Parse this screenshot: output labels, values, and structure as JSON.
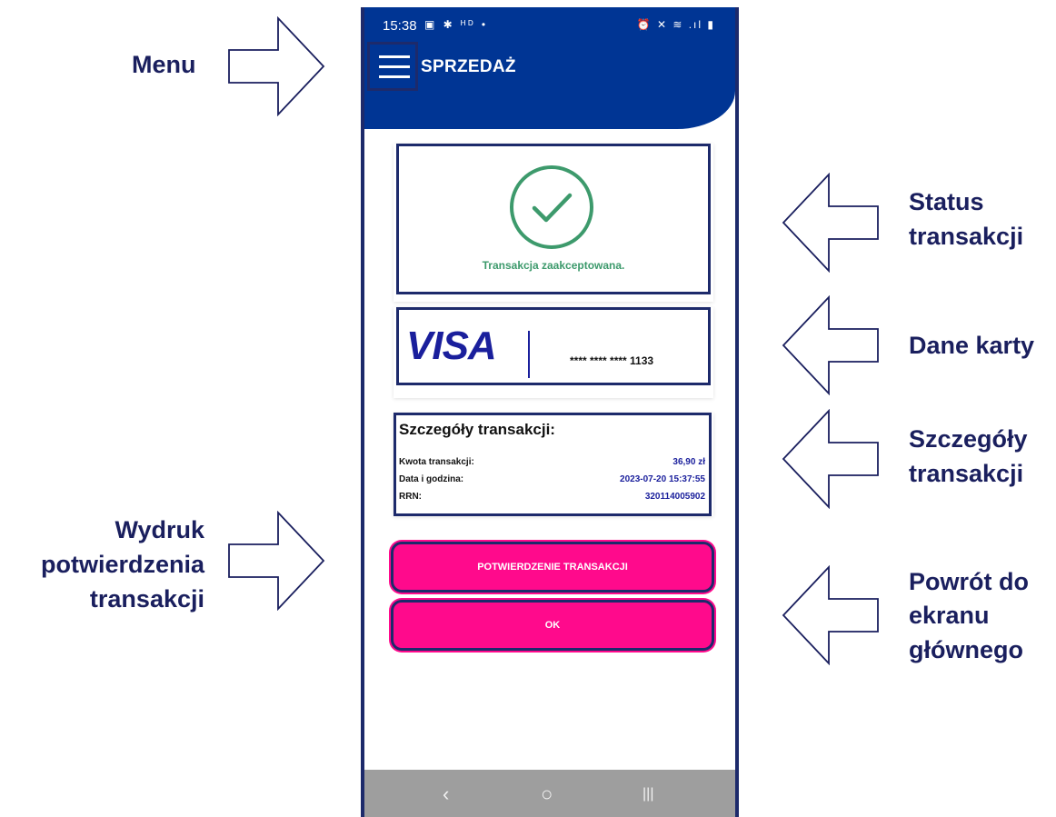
{
  "callouts": {
    "menu": "Menu",
    "status": [
      "Status",
      "transakcji"
    ],
    "card": "Dane karty",
    "details": [
      "Szczegóły",
      "transakcji"
    ],
    "print": [
      "Wydruk",
      "potwierdzenia",
      "transakcji"
    ],
    "back": [
      "Powrót do",
      "ekranu",
      "głównego"
    ]
  },
  "statusbar": {
    "time": "15:38",
    "left_icons": "▣ ✱ ᴴᴰ •",
    "right_icons": "⏰ ✕ ≋ .ıl ▮"
  },
  "header": {
    "menu_icon": "hamburger-icon",
    "title": "SPRZEDAŻ"
  },
  "status_card": {
    "icon": "check-circle-icon",
    "text": "Transakcja zaakceptowana."
  },
  "card_info": {
    "brand": "VISA",
    "number": "**** **** **** 1133"
  },
  "details": {
    "title": "Szczegóły transakcji:",
    "rows": [
      {
        "label": "Kwota transakcji:",
        "value": "36,90 zł"
      },
      {
        "label": "Data i godzina:",
        "value": "2023-07-20 15:37:55"
      },
      {
        "label": "RRN:",
        "value": "320114005902"
      }
    ]
  },
  "buttons": {
    "confirm": "POTWIERDZENIE TRANSAKCJI",
    "ok": "OK"
  },
  "navbar": {
    "back": "‹",
    "home": "○",
    "recents": "|||"
  },
  "colors": {
    "brand_blue": "#003594",
    "accent_pink": "#ff0a8c",
    "success_green": "#3d9a6c",
    "callout_navy": "#1a1f5e"
  }
}
